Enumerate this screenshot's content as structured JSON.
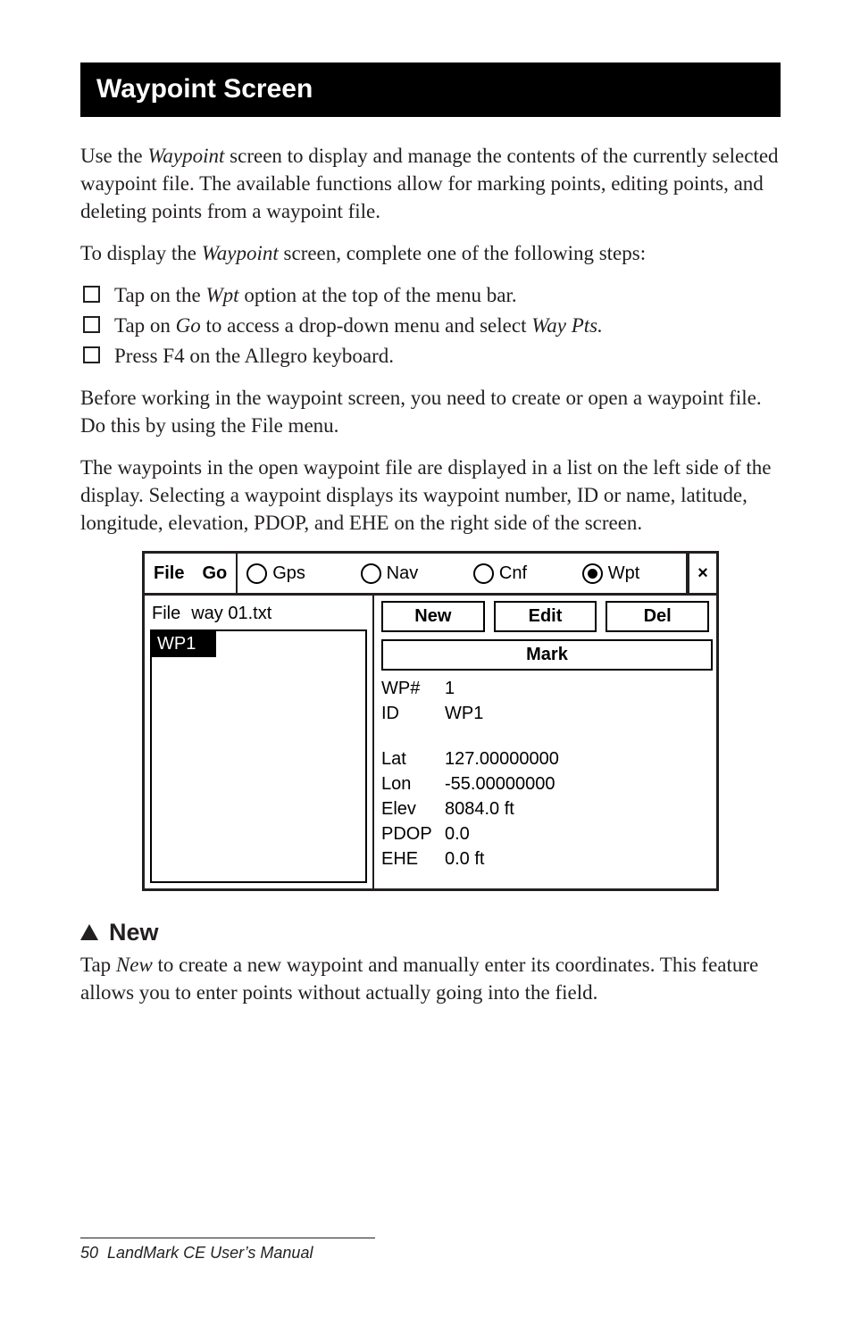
{
  "title": "Waypoint Screen",
  "intro": {
    "pre": "Use the ",
    "em": "Waypoint",
    "post": " screen to display and manage the contents of the currently selected waypoint file. The available functions allow for marking points, editing points, and deleting points from a waypoint file."
  },
  "toDisplay": {
    "pre": "To display the ",
    "em": "Waypoint",
    "post": " screen, complete one of the following steps:"
  },
  "bullets": [
    {
      "pre": "Tap on the ",
      "em": "Wpt",
      "post": " option at the top of the menu bar."
    },
    {
      "pre": "Tap on ",
      "em": "Go",
      "mid": " to access a drop-down menu and select ",
      "em2": "Way Pts.",
      "post": ""
    },
    {
      "pre": "Press F4 on the Allegro keyboard.",
      "em": "",
      "post": ""
    }
  ],
  "beforeWorking": "Before working in the waypoint screen, you need to create or open a waypoint file. Do this by using the File menu.",
  "waypointsPara": "The waypoints in the open waypoint file are displayed in a list on the left side of the display. Selecting a waypoint displays its waypoint number, ID or name, latitude, longitude, elevation, PDOP, and EHE on the right side of the screen.",
  "screenshot": {
    "menu": {
      "file": "File",
      "go": "Go",
      "gps": "Gps",
      "nav": "Nav",
      "cnf": "Cnf",
      "wpt": "Wpt",
      "close": "×"
    },
    "left": {
      "fileLabel": "File",
      "fileName": "way 01.txt",
      "selected": "WP1"
    },
    "buttons": {
      "new": "New",
      "edit": "Edit",
      "del": "Del",
      "mark": "Mark"
    },
    "fields": {
      "wpnum_k": "WP#",
      "wpnum_v": "1",
      "id_k": "ID",
      "id_v": "WP1",
      "lat_k": "Lat",
      "lat_v": "127.00000000",
      "lon_k": "Lon",
      "lon_v": "-55.00000000",
      "elev_k": "Elev",
      "elev_v": "8084.0 ft",
      "pdop_k": "PDOP",
      "pdop_v": "0.0",
      "ehe_k": "EHE",
      "ehe_v": "0.0 ft"
    }
  },
  "newSection": {
    "heading": "New",
    "body_pre": "Tap ",
    "body_em": "New",
    "body_post": " to create a new waypoint and manually enter its coordinates. This feature allows you to enter points without actually going into the field."
  },
  "footer": "50  LandMark CE User’s Manual"
}
